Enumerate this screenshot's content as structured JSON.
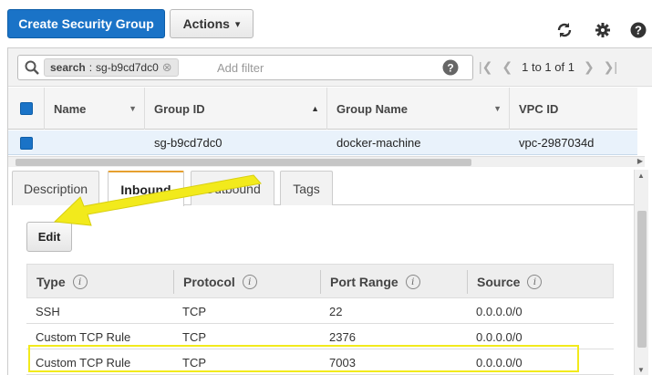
{
  "toolbar": {
    "create_label": "Create Security Group",
    "actions_label": "Actions",
    "actions_caret": "▾",
    "refresh_icon": "refresh-icon",
    "settings_icon": "gear-icon",
    "help_icon": "help-icon"
  },
  "search": {
    "chip_key": "search",
    "chip_sep": ":",
    "chip_value": "sg-b9cd7dc0",
    "chip_clear": "⊗",
    "placeholder": "Add filter"
  },
  "pager": {
    "text": "1 to 1 of 1",
    "first": "|❮",
    "prev": "❮",
    "next": "❯",
    "last": "❯|"
  },
  "grid": {
    "columns": [
      "Name",
      "Group ID",
      "Group Name",
      "VPC ID"
    ],
    "rows": [
      {
        "name": "",
        "group_id": "sg-b9cd7dc0",
        "group_name": "docker-machine",
        "vpc_id": "vpc-2987034d"
      }
    ]
  },
  "tabs": [
    {
      "label": "Description"
    },
    {
      "label": "Inbound"
    },
    {
      "label": "Outbound"
    },
    {
      "label": "Tags"
    }
  ],
  "edit_label": "Edit",
  "rules": {
    "columns": [
      "Type",
      "Protocol",
      "Port Range",
      "Source"
    ],
    "info_glyph": "i",
    "rows": [
      {
        "type": "SSH",
        "protocol": "TCP",
        "port": "22",
        "source": "0.0.0.0/0"
      },
      {
        "type": "Custom TCP Rule",
        "protocol": "TCP",
        "port": "2376",
        "source": "0.0.0.0/0"
      },
      {
        "type": "Custom TCP Rule",
        "protocol": "TCP",
        "port": "7003",
        "source": "0.0.0.0/0"
      }
    ]
  },
  "colors": {
    "primary": "#1a73c7",
    "annotation": "#f2ea1c",
    "tab_accent": "#e6a030"
  }
}
